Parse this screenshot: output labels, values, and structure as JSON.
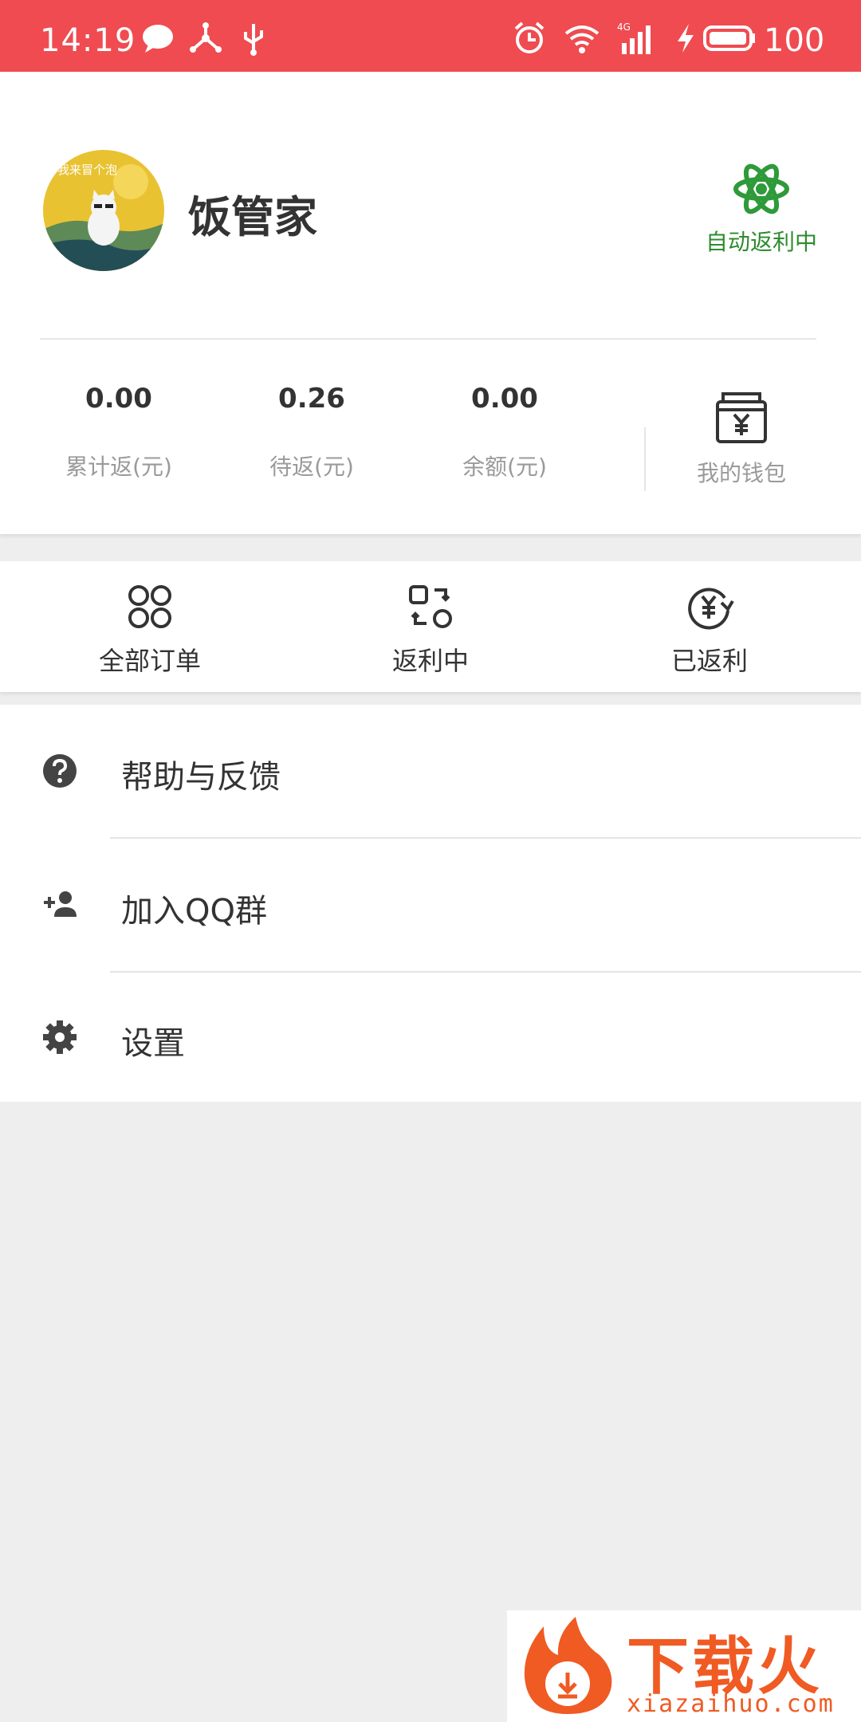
{
  "status_bar": {
    "time": "14:19",
    "battery": "100",
    "network": "4G",
    "icons": [
      "message-icon",
      "share-icon",
      "usb-icon",
      "alarm-icon",
      "wifi-icon",
      "signal-icon",
      "charging-icon",
      "battery-icon"
    ]
  },
  "profile": {
    "name": "饭管家",
    "avatar_icon": "cat-avatar",
    "avatar_text": "我来冒个泡",
    "auto_rebate_label": "自动返利中",
    "auto_rebate_color": "#2e8b2e"
  },
  "stats": [
    {
      "value": "0.00",
      "label": "累计返(元)"
    },
    {
      "value": "0.26",
      "label": "待返(元)"
    },
    {
      "value": "0.00",
      "label": "余额(元)"
    }
  ],
  "wallet": {
    "label": "我的钱包",
    "icon": "wallet-icon"
  },
  "orders": [
    {
      "label": "全部订单",
      "icon": "clover-icon"
    },
    {
      "label": "返利中",
      "icon": "exchange-icon"
    },
    {
      "label": "已返利",
      "icon": "yuan-refund-icon"
    }
  ],
  "menu": [
    {
      "label": "帮助与反馈",
      "icon": "help-icon"
    },
    {
      "label": "加入QQ群",
      "icon": "add-person-icon"
    },
    {
      "label": "设置",
      "icon": "gear-icon"
    }
  ],
  "watermark": {
    "title": "下载火",
    "subtitle": "xiazaihuo.com"
  },
  "colors": {
    "status_bar": "#ef4b50",
    "accent_green": "#2e8b2e",
    "watermark": "#f05a23"
  }
}
